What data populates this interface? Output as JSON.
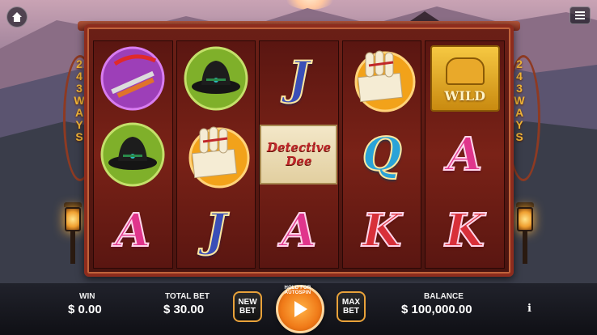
{
  "ways_text": [
    "2",
    "4",
    "3",
    "W",
    "A",
    "Y",
    "S"
  ],
  "symbols": {
    "A": "A",
    "J": "J",
    "Q": "Q",
    "K": "K",
    "wild": "WILD",
    "detective": "Detective Dee"
  },
  "reels": [
    [
      "sword-icon",
      "hat-icon",
      "A"
    ],
    [
      "hat-icon",
      "scroll-icon",
      "J"
    ],
    [
      "J",
      "detective",
      "A"
    ],
    [
      "scroll-icon",
      "Q",
      "K"
    ],
    [
      "wild",
      "A",
      "K"
    ]
  ],
  "bottom": {
    "win_label": "WIN",
    "win_value": "$ 0.00",
    "total_bet_label": "TOTAL BET",
    "total_bet_value": "$ 30.00",
    "new_bet": "NEW\nBET",
    "max_bet": "MAX\nBET",
    "spin_hint": "HOLD FOR AUTOSPIN",
    "balance_label": "BALANCE",
    "balance_value": "$ 100,000.00",
    "info": "i"
  }
}
